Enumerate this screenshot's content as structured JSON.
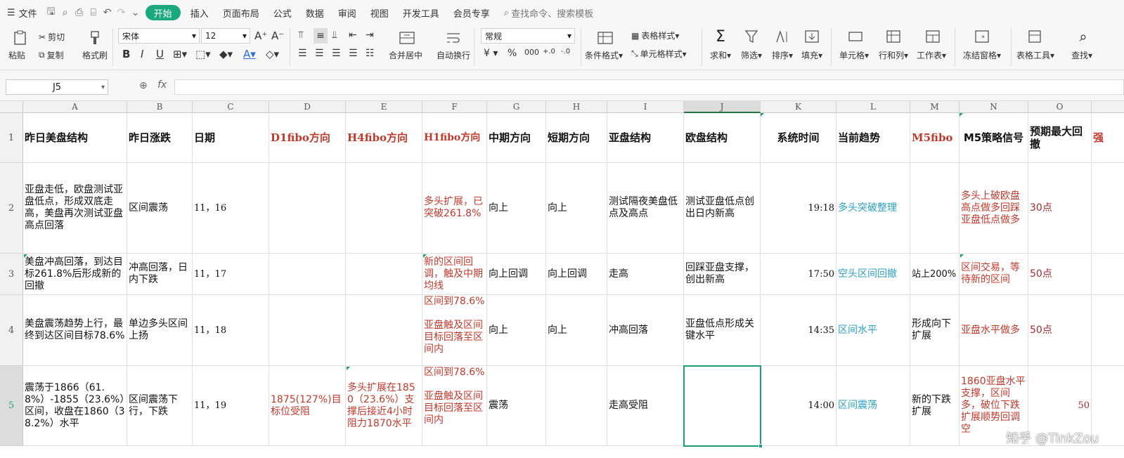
{
  "menubar": {
    "file": "文件",
    "tabs": [
      "开始",
      "插入",
      "页面布局",
      "公式",
      "数据",
      "审阅",
      "视图",
      "开发工具",
      "会员专享"
    ],
    "search_placeholder": "查找命令、搜索模板"
  },
  "ribbon": {
    "paste": "粘贴",
    "cut": "剪切",
    "copy": "复制",
    "format_painter": "格式刷",
    "font_name": "宋体",
    "font_size": "12",
    "merge_center": "合并居中",
    "wrap_text": "自动换行",
    "number_format": "常规",
    "conditional_format": "条件格式",
    "table_style": "表格样式",
    "cell_style": "单元格样式",
    "sum": "求和",
    "filter": "筛选",
    "sort": "排序",
    "fill": "填充",
    "cells": "单元格",
    "rows_cols": "行和列",
    "worksheet": "工作表",
    "freeze": "冻结窗格",
    "table_tools": "表格工具",
    "find": "查找"
  },
  "formula_bar": {
    "name_box": "J5",
    "fx": "fx",
    "content": ""
  },
  "columns": [
    "A",
    "B",
    "C",
    "D",
    "E",
    "F",
    "G",
    "H",
    "I",
    "J",
    "K",
    "L",
    "M",
    "N",
    "O"
  ],
  "rows": [
    "1",
    "2",
    "3",
    "4",
    "5"
  ],
  "cells": {
    "r1": [
      "昨日美盘结构",
      "昨日涨跌",
      "日期",
      "D1fibo方向",
      "H4fibo方向",
      "H1fibo方向",
      "中期方向",
      "短期方向",
      "亚盘结构",
      "欧盘结构",
      "系统时间",
      "当前趋势",
      "M5fibo",
      "M5策略信号",
      "预期最大回撤",
      "强"
    ],
    "r2": [
      "亚盘走低，欧盘测试亚盘低点，形成双底走高，美盘再次测试亚盘高点回落",
      "区间震荡",
      "11，16",
      "",
      "",
      "多头扩展，已突破261.8%",
      "向上",
      "向上",
      "测试隔夜美盘低点及高点",
      "测试亚盘低点创出日内新高",
      "19:18",
      "多头突破整理",
      "",
      "多头上破欧盘高点做多回踩亚盘低点做多",
      "30点"
    ],
    "r3": [
      "美盘冲高回落，到达目标261.8%后形成新的回撤",
      "冲高回落，日内下跌",
      "11，17",
      "",
      "",
      "新的区间回调，触及中期均线",
      "向上回调",
      "向上回调",
      "走高",
      "回踩亚盘支撑，创出新高",
      "17:50",
      "空头区间回撤",
      "站上200%",
      "区间交易，等待新的区间",
      "50点"
    ],
    "r4": [
      "美盘震荡趋势上行，最终到达区间目标78.6%",
      "单边多头区间上扬",
      "11，18",
      "",
      "",
      "区间到78.6%\n\n亚盘触及区间目标回落至区间内",
      "向上",
      "向上",
      "冲高回落",
      "亚盘低点形成关键水平",
      "14:35",
      "区间水平",
      "形成向下扩展",
      "亚盘水平做多",
      "50点"
    ],
    "r5": [
      "震荡于1866（61.8%）-1855（23.6%）区间，收盘在1860（38.2%）水平",
      "区间震荡下行，下跌",
      "11，19",
      "1875(127%)目标位受阻",
      "多头扩展在1850（23.6%）支撑后接近4小时阻力1870水平",
      "区间到78.6%\n\n亚盘触及区间目标回落至区间内",
      "震荡",
      "",
      "走高受阻",
      "",
      "14:00",
      "区间震荡",
      "新的下跌扩展",
      "1860亚盘水平支撑，区间多，破位下跌扩展顺势回调空",
      "50"
    ]
  },
  "watermark": "知乎 @TinkZou",
  "colors": {
    "accent": "#1aa97c",
    "red": "#c0392b",
    "teal": "#2aa2c0",
    "darkred": "#a52a2a"
  }
}
